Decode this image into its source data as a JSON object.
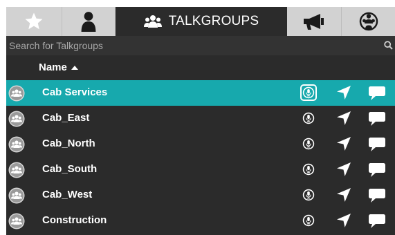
{
  "tabs": [
    {
      "id": "favorites",
      "icon": "star-icon",
      "label": ""
    },
    {
      "id": "users",
      "icon": "user-icon",
      "label": ""
    },
    {
      "id": "talkgroups",
      "icon": "group-icon",
      "label": "TALKGROUPS",
      "active": true
    },
    {
      "id": "broadcast",
      "icon": "megaphone-icon",
      "label": ""
    },
    {
      "id": "global",
      "icon": "globe-icon",
      "label": ""
    }
  ],
  "search": {
    "placeholder": "Search for Talkgroups",
    "value": ""
  },
  "list": {
    "column_name": "Name",
    "sort": "ascending",
    "rows": [
      {
        "name": "Cab Services",
        "selected": true
      },
      {
        "name": "Cab_East",
        "selected": false
      },
      {
        "name": "Cab_North",
        "selected": false
      },
      {
        "name": "Cab_South",
        "selected": false
      },
      {
        "name": "Cab_West",
        "selected": false
      },
      {
        "name": "Construction",
        "selected": false
      }
    ]
  },
  "colors": {
    "accent": "#17a9ad",
    "panel_bg": "#2b2b2b",
    "inactive_tab": "#d2d2d2"
  }
}
